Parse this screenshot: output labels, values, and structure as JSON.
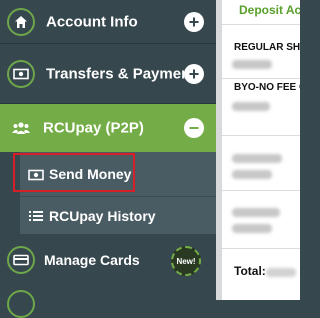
{
  "sidebar": {
    "items": [
      {
        "label": "Account Info",
        "icon": "home-icon"
      },
      {
        "label": "Transfers & Payments",
        "icon": "money-icon"
      },
      {
        "label": "RCUpay (P2P)",
        "icon": "people-icon",
        "expanded": true
      },
      {
        "label": "Send Money",
        "icon": "money-icon",
        "sub": true,
        "highlighted": true
      },
      {
        "label": "RCUpay History",
        "icon": "list-icon",
        "sub": true
      },
      {
        "label": "Manage Cards",
        "icon": "card-icon",
        "badge": "New!"
      }
    ]
  },
  "panel": {
    "title": "Deposit Acc",
    "label_1": "REGULAR SHA",
    "label_2": "BYO-NO FEE C",
    "total_label": "Total:"
  },
  "colors": {
    "sidebar_bg": "#36474e",
    "active_bg": "#74ad47",
    "sub_bg": "#4a5c63",
    "highlight": "#d42026",
    "accent_green": "#5aa02c"
  }
}
